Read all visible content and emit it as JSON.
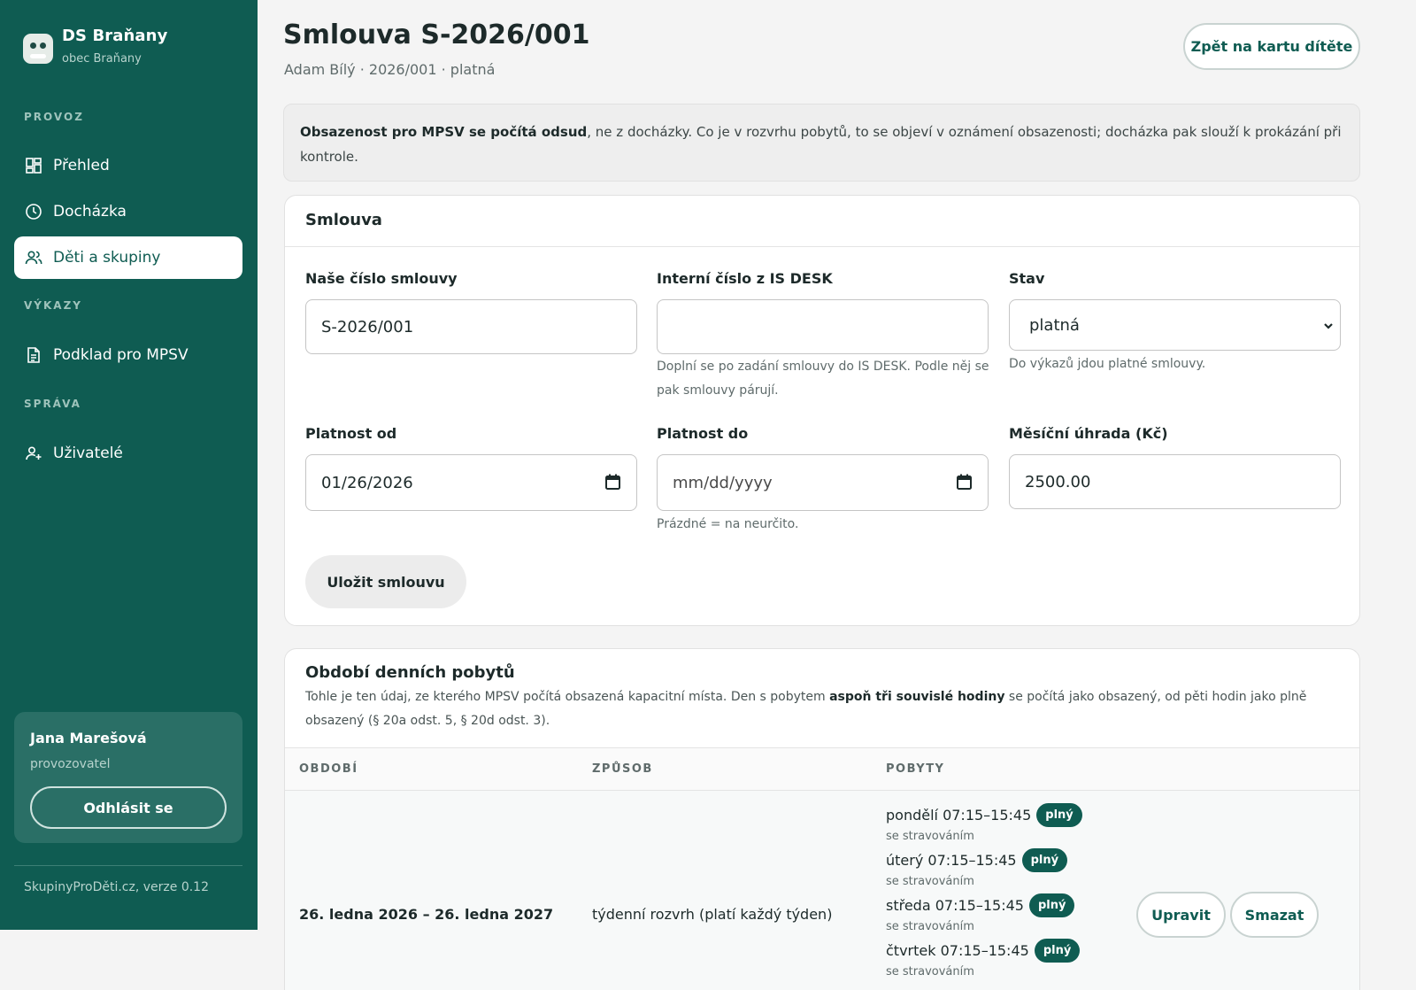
{
  "sidebar": {
    "brand_name": "DS Braňany",
    "brand_sub": "obec Braňany",
    "sections": {
      "provoz": "PROVOZ",
      "vykazy": "VÝKAZY",
      "sprava": "SPRÁVA"
    },
    "items": {
      "prehled": "Přehled",
      "dochazka": "Docházka",
      "deti": "Děti a skupiny",
      "podklad": "Podklad pro MPSV",
      "uzivatele": "Uživatelé"
    },
    "active_item": "Děti a skupiny",
    "user": {
      "name": "Jana Marešová",
      "role": "provozovatel",
      "logout_label": "Odhlásit se"
    },
    "version": "SkupinyProDěti.cz, verze 0.12"
  },
  "header": {
    "title": "Smlouva S-2026/001",
    "subtitle": "Adam Bílý · 2026/001 · platná",
    "back_label": "Zpět na kartu dítěte"
  },
  "notice": {
    "bold": "Obsazenost pro MPSV se počítá odsud",
    "rest": ", ne z docházky. Co je v rozvrhu pobytů, to se objeví v oznámení obsazenosti; docházka pak slouží k prokázání při kontrole."
  },
  "contract": {
    "heading": "Smlouva",
    "number_label": "Naše číslo smlouvy",
    "number_value": "S-2026/001",
    "internal_label": "Interní číslo z IS DESK",
    "internal_value": "",
    "internal_help": "Doplní se po zadání smlouvy do IS DESK. Podle něj se pak smlouvy párují.",
    "status_label": "Stav",
    "status_value": "platná",
    "status_help": "Do výkazů jdou platné smlouvy.",
    "from_label": "Platnost od",
    "from_value": "01/26/2026",
    "to_label": "Platnost do",
    "to_placeholder": "mm/dd/yyyy",
    "to_help": "Prázdné = na neurčito.",
    "fee_label": "Měsíční úhrada (Kč)",
    "fee_value": "2500.00",
    "save_label": "Uložit smlouvu"
  },
  "periods": {
    "heading": "Období denních pobytů",
    "desc_1": "Tohle je ten údaj, ze kterého MPSV počítá obsazená kapacitní místa. Den s pobytem ",
    "desc_bold": "aspoň tři souvislé hodiny",
    "desc_2": " se počítá jako obsazený, od pěti hodin jako plně obsazený (§ 20a odst. 5, § 20d odst. 3).",
    "columns": [
      "OBDOBÍ",
      "ZPŮSOB",
      "POBYTY"
    ],
    "rows": [
      {
        "period": "26. ledna 2026 – 26. ledna 2027",
        "mode": "týdenní rozvrh (platí každý týden)",
        "stays": [
          {
            "day": "pondělí 07:15–15:45",
            "badge": "plný",
            "note": "se stravováním"
          },
          {
            "day": "úterý 07:15–15:45",
            "badge": "plný",
            "note": "se stravováním"
          },
          {
            "day": "středa 07:15–15:45",
            "badge": "plný",
            "note": "se stravováním"
          },
          {
            "day": "čtvrtek 07:15–15:45",
            "badge": "plný",
            "note": "se stravováním"
          }
        ],
        "edit_label": "Upravit",
        "delete_label": "Smazat"
      }
    ]
  }
}
